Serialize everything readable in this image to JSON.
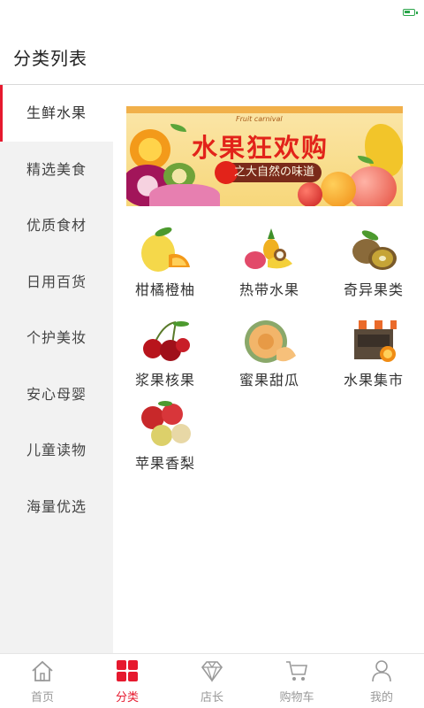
{
  "header": {
    "title": "分类列表"
  },
  "sidebar": {
    "items": [
      {
        "label": "生鲜水果",
        "active": true
      },
      {
        "label": "精选美食"
      },
      {
        "label": "优质食材"
      },
      {
        "label": "日用百货"
      },
      {
        "label": "个护美妆"
      },
      {
        "label": "安心母婴"
      },
      {
        "label": "儿童读物"
      },
      {
        "label": "海量优选"
      }
    ]
  },
  "banner": {
    "sub_small": "Fruit carnival",
    "title": "水果狂欢购",
    "tagline": "之大自然の味道"
  },
  "categories": [
    {
      "label": "柑橘橙柚",
      "icon": "citrus-icon"
    },
    {
      "label": "热带水果",
      "icon": "tropical-fruit-icon"
    },
    {
      "label": "奇异果类",
      "icon": "kiwi-icon"
    },
    {
      "label": "浆果核果",
      "icon": "cherry-icon"
    },
    {
      "label": "蜜果甜瓜",
      "icon": "melon-icon"
    },
    {
      "label": "水果集市",
      "icon": "fruit-stand-icon"
    },
    {
      "label": "苹果香梨",
      "icon": "apple-pear-icon"
    }
  ],
  "tabbar": {
    "items": [
      {
        "label": "首页",
        "icon": "home-icon"
      },
      {
        "label": "分类",
        "icon": "category-grid-icon",
        "active": true
      },
      {
        "label": "店长",
        "icon": "diamond-icon"
      },
      {
        "label": "购物车",
        "icon": "cart-icon"
      },
      {
        "label": "我的",
        "icon": "user-icon"
      }
    ]
  },
  "colors": {
    "accent": "#e6192e",
    "sidebar_bg": "#f2f2f2",
    "inactive_text": "#999999"
  }
}
